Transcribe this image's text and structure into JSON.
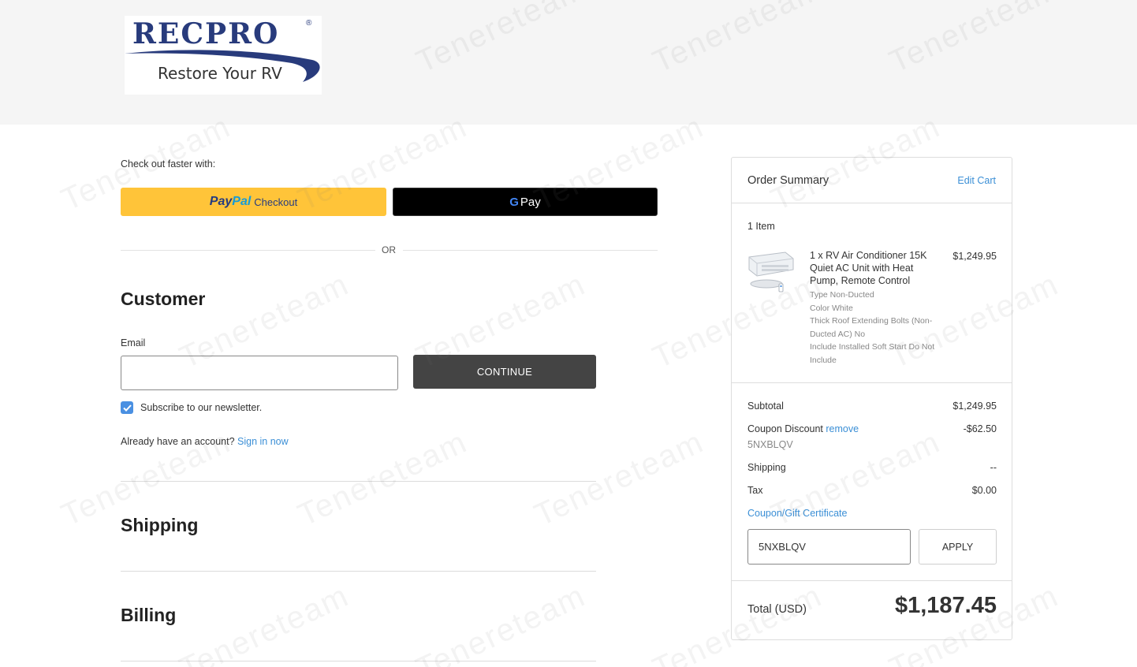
{
  "header": {
    "logo_word": "RECPRO",
    "logo_reg": "®",
    "logo_tagline": "Restore Your RV"
  },
  "checkout": {
    "faster_label": "Check out faster with:",
    "paypal_pay": "Pay",
    "paypal_pal": "Pal",
    "paypal_text": "Checkout",
    "gpay_g": "G",
    "gpay_text": "Pay",
    "or_text": "OR"
  },
  "customer": {
    "title": "Customer",
    "email_label": "Email",
    "email_value": "",
    "continue_label": "CONTINUE",
    "newsletter_label": "Subscribe to our newsletter.",
    "newsletter_checked": true,
    "account_text": "Already have an account?",
    "signin_link": "Sign in now"
  },
  "shipping": {
    "title": "Shipping"
  },
  "billing": {
    "title": "Billing"
  },
  "summary": {
    "title": "Order Summary",
    "edit_cart": "Edit Cart",
    "item_count": "1 Item",
    "product": {
      "name": "1 x RV Air Conditioner 15K Quiet AC Unit with Heat Pump, Remote Control",
      "price": "$1,249.95",
      "options": [
        "Type Non-Ducted",
        "Color White",
        "Thick Roof Extending Bolts (Non-Ducted AC) No",
        "Include Installed Soft Start Do Not Include"
      ]
    },
    "subtotal_label": "Subtotal",
    "subtotal_value": "$1,249.95",
    "coupon_label": "Coupon Discount",
    "coupon_remove": "remove",
    "coupon_code": "5NXBLQV",
    "coupon_value": "-$62.50",
    "shipping_label": "Shipping",
    "shipping_value": "--",
    "tax_label": "Tax",
    "tax_value": "$0.00",
    "coupon_link": "Coupon/Gift Certificate",
    "coupon_input_value": "5NXBLQV",
    "apply_label": "APPLY",
    "total_label": "Total (USD)",
    "total_value": "$1,187.45"
  },
  "watermark": {
    "text": "Tenereteam"
  },
  "colors": {
    "paypal_yellow": "#ffc439",
    "link_blue": "#3b8fd6",
    "continue_dark": "#444444",
    "checkbox_blue": "#4a90e2"
  }
}
